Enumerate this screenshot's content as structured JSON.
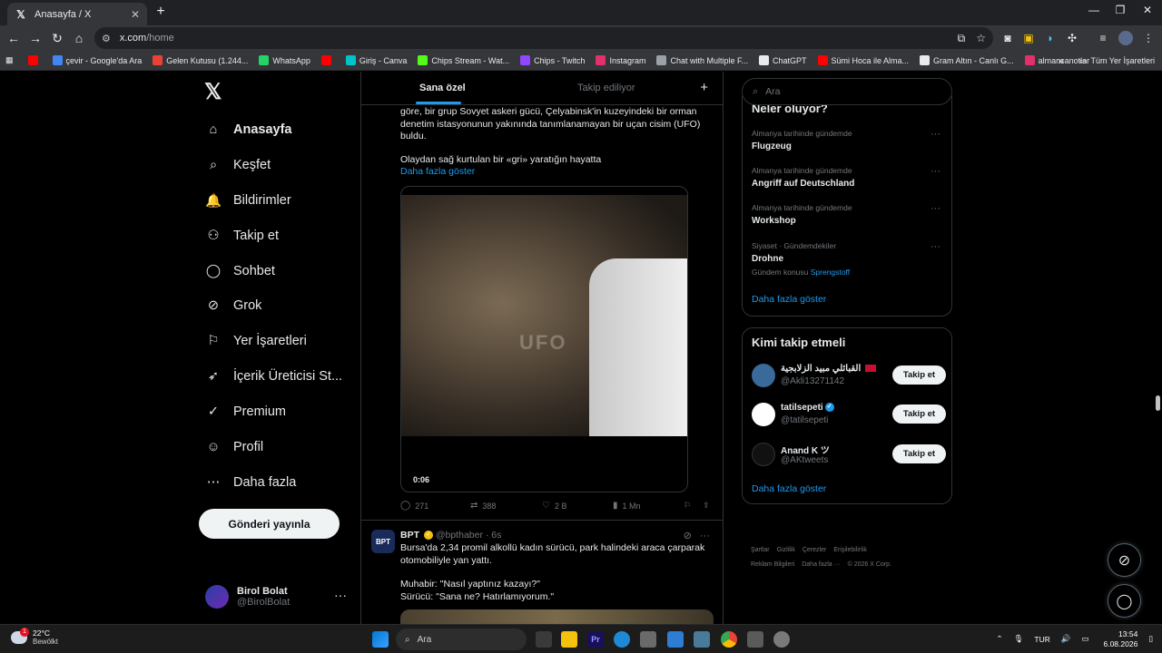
{
  "browser": {
    "tab_title": "Anasayfa / X",
    "tab_close": "✕",
    "new_tab": "+",
    "win_min": "—",
    "win_max": "❐",
    "win_close": "✕",
    "url_host": "x.com",
    "url_path": "/home",
    "bookmarks": [
      {
        "label": "",
        "color": "#ff0000"
      },
      {
        "label": "çevir - Google'da Ara",
        "color": "#4285f4"
      },
      {
        "label": "Gelen Kutusu (1.244...",
        "color": "#ea4335"
      },
      {
        "label": "WhatsApp",
        "color": "#25d366"
      },
      {
        "label": "",
        "color": "#ff0000"
      },
      {
        "label": "Giriş - Canva",
        "color": "#00c4cc"
      },
      {
        "label": "Chips Stream - Wat...",
        "color": "#53fc18"
      },
      {
        "label": "Chips - Twitch",
        "color": "#9146ff"
      },
      {
        "label": "Instagram",
        "color": "#e1306c"
      },
      {
        "label": "Chat with Multiple F...",
        "color": "#9aa0a6"
      },
      {
        "label": "ChatGPT",
        "color": "#e8eaed"
      },
      {
        "label": "Sümi Hoca ile Alma...",
        "color": "#ff0000"
      },
      {
        "label": "Gram Altın - Canlı G...",
        "color": "#e8eaed"
      },
      {
        "label": "almancanotlar",
        "color": "#e1306c"
      }
    ],
    "bookmarks_more": "»",
    "all_bookmarks": "Tüm Yer İşaretleri"
  },
  "nav": {
    "logo": "𝕏",
    "items": [
      {
        "label": "Anasayfa",
        "icon": "home-icon",
        "glyph": "⌂"
      },
      {
        "label": "Keşfet",
        "icon": "search-icon",
        "glyph": "⌕"
      },
      {
        "label": "Bildirimler",
        "icon": "bell-icon",
        "glyph": "🔔"
      },
      {
        "label": "Takip et",
        "icon": "follow-icon",
        "glyph": "⚇"
      },
      {
        "label": "Sohbet",
        "icon": "chat-icon",
        "glyph": "◯"
      },
      {
        "label": "Grok",
        "icon": "grok-icon",
        "glyph": "⊘"
      },
      {
        "label": "Yer İşaretleri",
        "icon": "bookmark-icon",
        "glyph": "⚐"
      },
      {
        "label": "İçerik Üreticisi St...",
        "icon": "rocket-icon",
        "glyph": "➶"
      },
      {
        "label": "Premium",
        "icon": "verified-icon",
        "glyph": "✓"
      },
      {
        "label": "Profil",
        "icon": "profile-icon",
        "glyph": "☺"
      },
      {
        "label": "Daha fazla",
        "icon": "more-circle-icon",
        "glyph": "⋯"
      }
    ],
    "post_button": "Gönderi yayınla",
    "account_name": "Birol Bolat",
    "account_handle": "@BirolBolat",
    "account_more": "···"
  },
  "timeline": {
    "tab_foryou": "Sana özel",
    "tab_following": "Takip ediliyor",
    "plus": "+",
    "tweet1": {
      "text_a": "göre, bir grup Sovyet askeri gücü, Çelyabinsk'in kuzeyindeki bir orman denetim istasyonunun yakınında tanımlanamayan bir uçan cisim (UFO) buldu.",
      "text_b": "Olaydan sağ kurtulan bir «gri» yaratığın hayatta",
      "show_more": "Daha fazla göster",
      "video_watermark": "UFO",
      "video_time": "0:06",
      "replies": "271",
      "reposts": "388",
      "likes": "2 B",
      "views": "1 Mn"
    },
    "tweet2": {
      "avatar_text": "BPT",
      "name": "BPT",
      "handle": "@bpthaber · 6s",
      "text_a": "Bursa'da 2,34 promil alkollü kadın sürücü, park halindeki araca çarparak otomobiliyle yan yattı.",
      "text_b": "Muhabir: \"Nasıl yaptınız kazayı?\"",
      "text_c": "Sürücü: \"Sana ne? Hatırlamıyorum.\""
    }
  },
  "right": {
    "search_placeholder": "Ara",
    "trends_title": "Neler oluyor?",
    "trends": [
      {
        "context": "Almanya tarihinde gündemde",
        "name": "Flugzeug",
        "sub_prefix": "",
        "sub_link": ""
      },
      {
        "context": "Almanya tarihinde gündemde",
        "name": "Angriff auf Deutschland",
        "sub_prefix": "",
        "sub_link": ""
      },
      {
        "context": "Almanya tarihinde gündemde",
        "name": "Workshop",
        "sub_prefix": "",
        "sub_link": ""
      },
      {
        "context": "Siyaset · Gündemdekiler",
        "name": "Drohne",
        "sub_prefix": "Gündem konusu ",
        "sub_link": "Sprengstoff"
      }
    ],
    "trends_more": "Daha fazla göster",
    "who_title": "Kimi takip etmeli",
    "who": [
      {
        "name": "القبائلي مبيد الزلابجية",
        "handle": "@Akli13271142",
        "button": "Takip et",
        "avatar_color": "#3a6a9a"
      },
      {
        "name": "tatilsepeti",
        "handle": "@tatilsepeti",
        "button": "Takip et",
        "avatar_color": "#ffffff"
      },
      {
        "name": "Anand K ツ",
        "handle": "@AKtweets",
        "button": "Takip et",
        "avatar_color": "#111111"
      }
    ],
    "who_more": "Daha fazla göster",
    "footer_line1": [
      "Şartlar",
      "Gizlilik",
      "Çerezler",
      "Erişilebilirlik"
    ],
    "footer_line2": [
      "Reklam Bilgileri",
      "Daha fazla ···",
      "© 2026 X Corp."
    ]
  },
  "taskbar": {
    "temp": "22°C",
    "weather": "Bewölkt",
    "weather_badge": "1",
    "search": "Ara",
    "lang": "TUR",
    "time": "13:54",
    "date": "6.08.2026"
  }
}
